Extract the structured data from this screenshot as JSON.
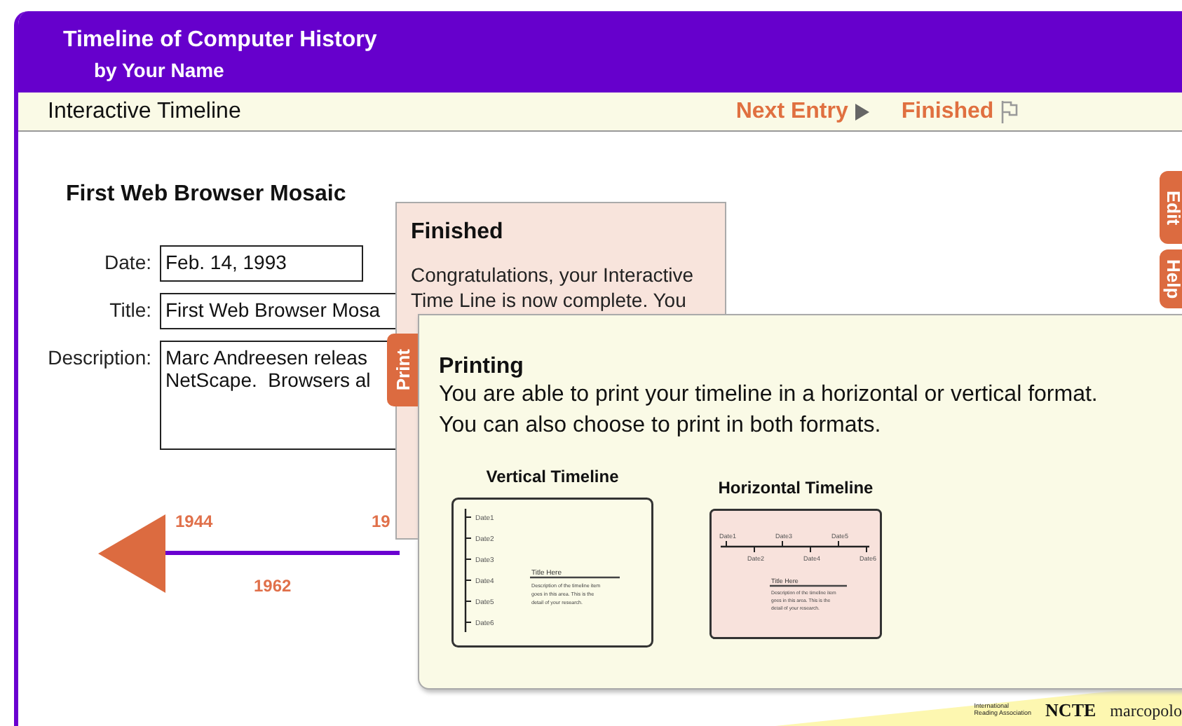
{
  "header": {
    "title": "Timeline of Computer History",
    "byline": "by  Your Name"
  },
  "toolbar": {
    "title": "Interactive Timeline",
    "next_entry": "Next Entry",
    "finished": "Finished"
  },
  "entry": {
    "heading": "First Web Browser Mosaic",
    "fields": [
      {
        "label": "Date:",
        "value": "Feb. 14, 1993"
      },
      {
        "label": "Title:",
        "value": "First Web Browser Mosa"
      },
      {
        "label": "Description:",
        "value": "Marc Andreesen releas\nNetScape.  Browsers al"
      }
    ]
  },
  "timeline": {
    "labels": [
      {
        "text": "1944",
        "kind": "above"
      },
      {
        "text": "1962",
        "kind": "below"
      },
      {
        "text": "19",
        "kind": "above"
      }
    ]
  },
  "side_tabs": [
    {
      "label": "Edit"
    },
    {
      "label": "Help"
    }
  ],
  "finished_popup": {
    "title": "Finished",
    "lines": [
      "Congratulations, your Interactive",
      "Time Line is now complete. You"
    ]
  },
  "print_tab": "Print",
  "printing_popup": {
    "title": "Printing",
    "lines": [
      "You are able to print your timeline in a horizontal or vertical format.",
      "You can also choose to print in both formats."
    ],
    "samples": [
      {
        "kind": "vertical",
        "title": "Vertical Timeline",
        "dates": [
          "Date1",
          "Date2",
          "Date3",
          "Date4",
          "Date5",
          "Date6"
        ],
        "item_title": "Title Here",
        "item_lines": [
          "Description of the timeline item",
          "goes in this area.  This is the",
          "detail of your research."
        ]
      },
      {
        "kind": "horizontal",
        "title": "Horizontal Timeline",
        "dates": [
          "Date1",
          "Date2",
          "Date3",
          "Date4",
          "Date5",
          "Date6"
        ],
        "item_title": "Title Here",
        "item_lines": [
          "Description of the timeline item",
          "goes in this area. This is the",
          "detail of your research."
        ]
      }
    ]
  },
  "footer": {
    "logos": [
      "International\nReading Association",
      "NCTE",
      "marcopolo"
    ]
  }
}
